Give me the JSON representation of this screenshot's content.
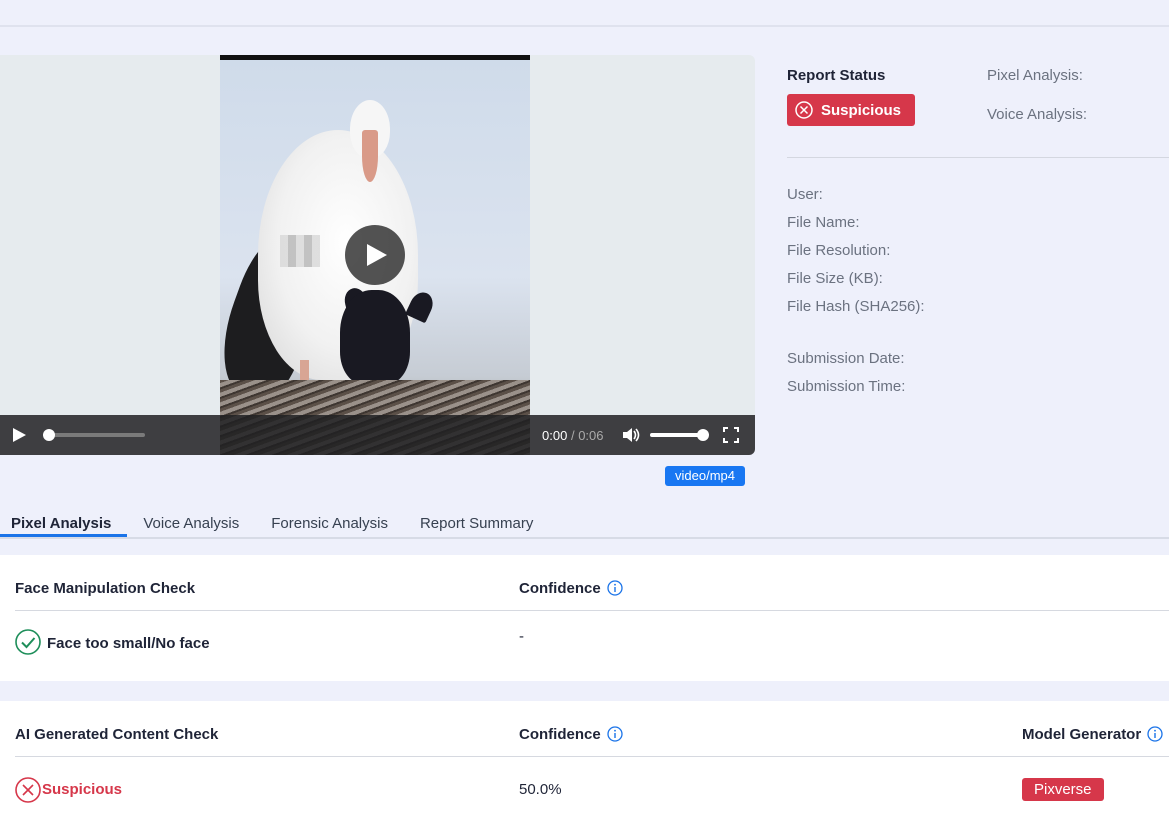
{
  "player": {
    "time_current": "0:00",
    "time_sep": "/",
    "time_duration": "0:06",
    "mime": "video/mp4",
    "progress": 0.0,
    "volume": 1.0
  },
  "report": {
    "status_title": "Report Status",
    "status_value": "Suspicious",
    "pixel_analysis_label": "Pixel Analysis:",
    "voice_analysis_label": "Voice Analysis:",
    "user_label": "User:",
    "file_name_label": "File Name:",
    "file_resolution_label": "File Resolution:",
    "file_size_label": "File Size (KB):",
    "file_hash_label": "File Hash (SHA256):",
    "submission_date_label": "Submission Date:",
    "submission_time_label": "Submission Time:"
  },
  "tabs": [
    {
      "label": "Pixel Analysis",
      "active": true
    },
    {
      "label": "Voice Analysis",
      "active": false
    },
    {
      "label": "Forensic Analysis",
      "active": false
    },
    {
      "label": "Report Summary",
      "active": false
    }
  ],
  "face_check": {
    "header": "Face Manipulation Check",
    "confidence_header": "Confidence",
    "result": "Face too small/No face",
    "confidence": "-"
  },
  "ai_check": {
    "header": "AI Generated Content Check",
    "confidence_header": "Confidence",
    "model_header": "Model Generator",
    "result": "Suspicious",
    "confidence": "50.0%",
    "model": "Pixverse"
  },
  "colors": {
    "accent": "#1a73e8",
    "danger": "#d6374a",
    "success": "#1e8e5a"
  }
}
